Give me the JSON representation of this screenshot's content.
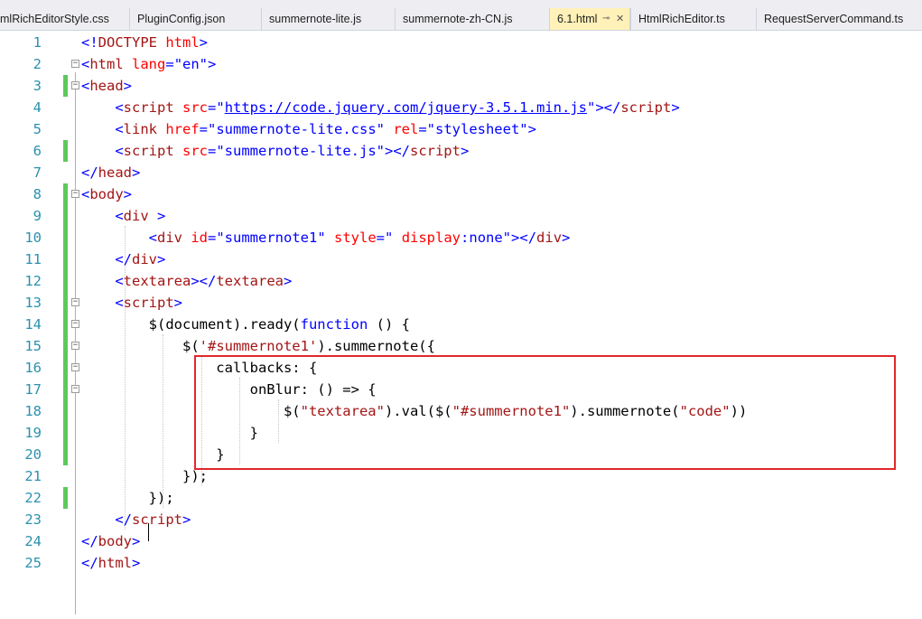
{
  "tabs": [
    {
      "label": "mlRichEditorStyle.css",
      "active": false
    },
    {
      "label": "PluginConfig.json",
      "active": false
    },
    {
      "label": "summernote-lite.js",
      "active": false
    },
    {
      "label": "summernote-zh-CN.js",
      "active": false
    },
    {
      "label": "6.1.html",
      "active": true,
      "pinned": true
    },
    {
      "label": "HtmlRichEditor.ts",
      "active": false
    },
    {
      "label": "RequestServerCommand.ts",
      "active": false
    }
  ],
  "icons": {
    "pin": "pin-icon",
    "close": "close-icon",
    "fold_collapse": "minus-box-icon"
  },
  "colors": {
    "active_tab": "#fff1b8",
    "change_marker": "#5dc95d",
    "highlight_box": "#e0282c",
    "line_numbers": "#2b91af",
    "tag": "#a31515",
    "attribute": "#ff0000",
    "value": "#0000ff"
  },
  "editor": {
    "line_numbers": [
      "1",
      "2",
      "3",
      "4",
      "5",
      "6",
      "7",
      "8",
      "9",
      "10",
      "11",
      "12",
      "13",
      "14",
      "15",
      "16",
      "17",
      "18",
      "19",
      "20",
      "21",
      "22",
      "23",
      "24",
      "25"
    ],
    "lines": [
      {
        "segments": [
          [
            "bl",
            "<!"
          ],
          [
            "tg",
            "DOCTYPE"
          ],
          [
            "at",
            " html"
          ],
          [
            "bl",
            ">"
          ]
        ]
      },
      {
        "segments": [
          [
            "bl",
            "<"
          ],
          [
            "tg",
            "html"
          ],
          [
            "at",
            " lang"
          ],
          [
            "bl",
            "="
          ],
          [
            "st",
            "\"en\""
          ],
          [
            "bl",
            ">"
          ]
        ]
      },
      {
        "segments": [
          [
            "bl",
            "<"
          ],
          [
            "tg",
            "head"
          ],
          [
            "bl",
            ">"
          ]
        ]
      },
      {
        "segments": [
          [
            "js",
            "    "
          ],
          [
            "bl",
            "<"
          ],
          [
            "tg",
            "script"
          ],
          [
            "at",
            " src"
          ],
          [
            "bl",
            "="
          ],
          [
            "st",
            "\""
          ],
          [
            "ul",
            "https://code.jquery.com/jquery-3.5.1.min.js"
          ],
          [
            "st",
            "\""
          ],
          [
            "bl",
            "></"
          ],
          [
            "tg",
            "script"
          ],
          [
            "bl",
            ">"
          ]
        ]
      },
      {
        "segments": [
          [
            "js",
            "    "
          ],
          [
            "bl",
            "<"
          ],
          [
            "tg",
            "link"
          ],
          [
            "at",
            " href"
          ],
          [
            "bl",
            "="
          ],
          [
            "st",
            "\"summernote-lite.css\""
          ],
          [
            "at",
            " rel"
          ],
          [
            "bl",
            "="
          ],
          [
            "st",
            "\"stylesheet\""
          ],
          [
            "bl",
            ">"
          ]
        ]
      },
      {
        "segments": [
          [
            "js",
            "    "
          ],
          [
            "bl",
            "<"
          ],
          [
            "tg",
            "script"
          ],
          [
            "at",
            " src"
          ],
          [
            "bl",
            "="
          ],
          [
            "st",
            "\"summernote-lite.js\""
          ],
          [
            "bl",
            "></"
          ],
          [
            "tg",
            "script"
          ],
          [
            "bl",
            ">"
          ]
        ]
      },
      {
        "segments": [
          [
            "bl",
            "</"
          ],
          [
            "tg",
            "head"
          ],
          [
            "bl",
            ">"
          ]
        ]
      },
      {
        "segments": [
          [
            "bl",
            "<"
          ],
          [
            "tg",
            "body"
          ],
          [
            "bl",
            ">"
          ]
        ]
      },
      {
        "segments": [
          [
            "js",
            "    "
          ],
          [
            "bl",
            "<"
          ],
          [
            "tg",
            "div"
          ],
          [
            "bl",
            " >"
          ]
        ]
      },
      {
        "segments": [
          [
            "js",
            "        "
          ],
          [
            "bl",
            "<"
          ],
          [
            "tg",
            "div"
          ],
          [
            "at",
            " id"
          ],
          [
            "bl",
            "="
          ],
          [
            "st",
            "\"summernote1\""
          ],
          [
            "at",
            " style"
          ],
          [
            "bl",
            "="
          ],
          [
            "st",
            "\" "
          ],
          [
            "at",
            "display"
          ],
          [
            "bl",
            ":"
          ],
          [
            "st",
            "none\""
          ],
          [
            "bl",
            "></"
          ],
          [
            "tg",
            "div"
          ],
          [
            "bl",
            ">"
          ]
        ]
      },
      {
        "segments": [
          [
            "js",
            "    "
          ],
          [
            "bl",
            "</"
          ],
          [
            "tg",
            "div"
          ],
          [
            "bl",
            ">"
          ]
        ]
      },
      {
        "segments": [
          [
            "js",
            "    "
          ],
          [
            "bl",
            "<"
          ],
          [
            "tg",
            "textarea"
          ],
          [
            "bl",
            "></"
          ],
          [
            "tg",
            "textarea"
          ],
          [
            "bl",
            ">"
          ]
        ]
      },
      {
        "segments": [
          [
            "js",
            "    "
          ],
          [
            "bl",
            "<"
          ],
          [
            "tg",
            "script"
          ],
          [
            "bl",
            ">"
          ]
        ]
      },
      {
        "segments": [
          [
            "js",
            "        $(document).ready("
          ],
          [
            "kw",
            "function"
          ],
          [
            "js",
            " () {"
          ]
        ]
      },
      {
        "segments": [
          [
            "js",
            "            $("
          ],
          [
            "jss",
            "'#summernote1'"
          ],
          [
            "js",
            ").summernote({"
          ]
        ]
      },
      {
        "segments": [
          [
            "js",
            "                callbacks: {"
          ]
        ]
      },
      {
        "segments": [
          [
            "js",
            "                    onBlur: () => {"
          ]
        ]
      },
      {
        "segments": [
          [
            "js",
            "                        $("
          ],
          [
            "jss",
            "\"textarea\""
          ],
          [
            "js",
            ").val($("
          ],
          [
            "jss",
            "\"#summernote1\""
          ],
          [
            "js",
            ").summernote("
          ],
          [
            "jss",
            "\"code\""
          ],
          [
            "js",
            "))"
          ]
        ]
      },
      {
        "segments": [
          [
            "js",
            "                    }"
          ]
        ]
      },
      {
        "segments": [
          [
            "js",
            "                }"
          ]
        ]
      },
      {
        "segments": [
          [
            "js",
            "            });"
          ]
        ]
      },
      {
        "segments": [
          [
            "js",
            "        });"
          ]
        ]
      },
      {
        "segments": [
          [
            "js",
            "    "
          ],
          [
            "bl",
            "</"
          ],
          [
            "tg",
            "script"
          ],
          [
            "bl",
            ">"
          ]
        ]
      },
      {
        "segments": [
          [
            "bl",
            "</"
          ],
          [
            "tg",
            "body"
          ],
          [
            "bl",
            ">"
          ]
        ]
      },
      {
        "segments": [
          [
            "bl",
            "</"
          ],
          [
            "tg",
            "html"
          ],
          [
            "bl",
            ">"
          ]
        ]
      }
    ]
  }
}
